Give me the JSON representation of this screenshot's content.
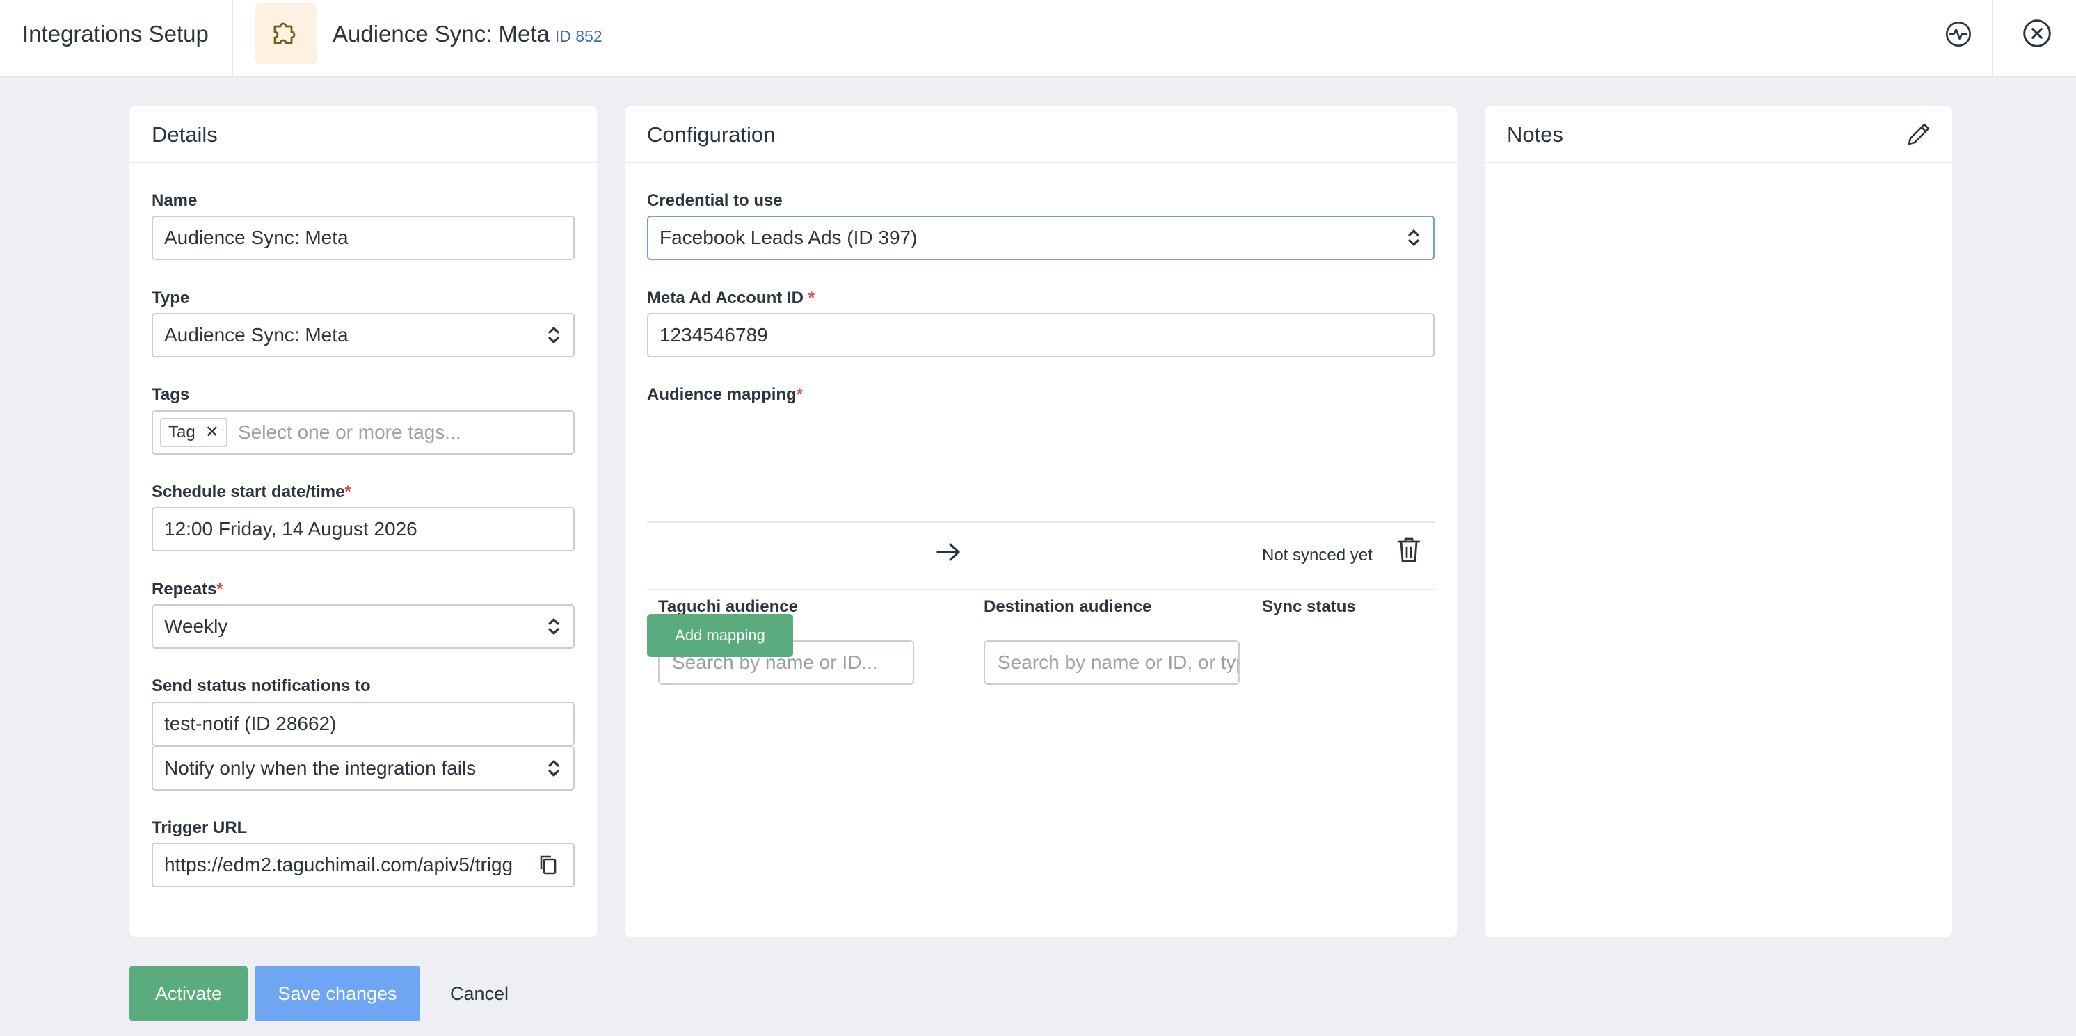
{
  "header": {
    "app_title": "Integrations Setup",
    "integration_title": "Audience Sync: Meta",
    "integration_id": "ID 852",
    "icons": {
      "integration": "puzzle-icon",
      "activity": "activity-icon",
      "close": "close-circle-icon"
    }
  },
  "details": {
    "title": "Details",
    "name_label": "Name",
    "name_value": "Audience Sync: Meta",
    "type_label": "Type",
    "type_value": "Audience Sync: Meta",
    "tags_label": "Tags",
    "tag_chip": "Tag",
    "tags_placeholder": "Select one or more tags...",
    "schedule_label": "Schedule start date/time",
    "schedule_value": "12:00 Friday, 14 August 2026",
    "repeats_label": "Repeats",
    "repeats_value": "Weekly",
    "notify_label": "Send status notifications to",
    "notify_value": "test-notif (ID 28662)",
    "notify_mode": "Notify only when the integration fails",
    "trigger_label": "Trigger URL",
    "trigger_value": "https://edm2.taguchimail.com/apiv5/trigg",
    "required_mark": "*"
  },
  "configuration": {
    "title": "Configuration",
    "credential_label": "Credential to use",
    "credential_value": "Facebook Leads Ads (ID 397)",
    "account_label": "Meta Ad Account ID",
    "account_value": "1234546789",
    "mapping_label": "Audience mapping",
    "required_mark": "*",
    "columns": [
      "Taguchi audience",
      "Destination audience",
      "Sync status"
    ],
    "rows": [
      {
        "source_placeholder": "Search by name or ID...",
        "dest_placeholder": "Search by name or ID, or type",
        "status": "Not synced yet"
      }
    ],
    "add_mapping": "Add mapping"
  },
  "notes": {
    "title": "Notes",
    "icon": "pencil-icon"
  },
  "footer": {
    "activate": "Activate",
    "save": "Save changes",
    "cancel": "Cancel"
  },
  "colors": {
    "green": "#5aab7e",
    "blue": "#6ea6f3",
    "accent_icon_bg": "#fdf1e2",
    "required": "#d9534f"
  }
}
